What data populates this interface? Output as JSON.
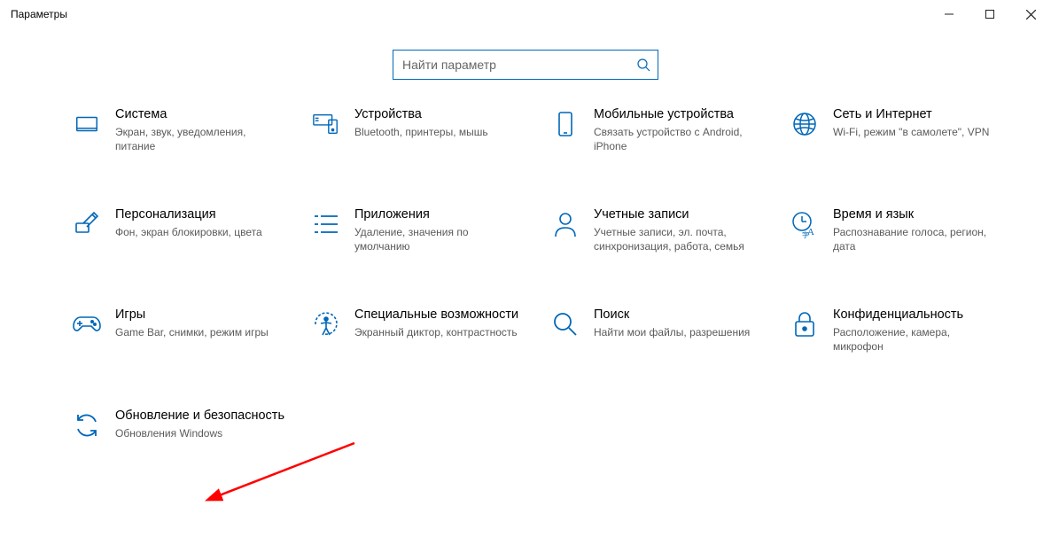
{
  "window": {
    "title": "Параметры"
  },
  "search": {
    "placeholder": "Найти параметр"
  },
  "tiles": {
    "system": {
      "title": "Система",
      "desc": "Экран, звук, уведомления, питание"
    },
    "devices": {
      "title": "Устройства",
      "desc": "Bluetooth, принтеры, мышь"
    },
    "phone": {
      "title": "Мобильные устройства",
      "desc": "Связать устройство с Android, iPhone"
    },
    "network": {
      "title": "Сеть и Интернет",
      "desc": "Wi-Fi, режим \"в самолете\", VPN"
    },
    "personalize": {
      "title": "Персонализация",
      "desc": "Фон, экран блокировки, цвета"
    },
    "apps": {
      "title": "Приложения",
      "desc": "Удаление, значения по умолчанию"
    },
    "accounts": {
      "title": "Учетные записи",
      "desc": "Учетные записи, эл. почта, синхронизация, работа, семья"
    },
    "time": {
      "title": "Время и язык",
      "desc": "Распознавание голоса, регион, дата"
    },
    "gaming": {
      "title": "Игры",
      "desc": "Game Bar, снимки, режим игры"
    },
    "ease": {
      "title": "Специальные возможности",
      "desc": "Экранный диктор, контрастность"
    },
    "searchCat": {
      "title": "Поиск",
      "desc": "Найти мои файлы, разрешения"
    },
    "privacy": {
      "title": "Конфиденциальность",
      "desc": "Расположение, камера, микрофон"
    },
    "update": {
      "title": "Обновление и безопасность",
      "desc": "Обновления Windows"
    }
  }
}
